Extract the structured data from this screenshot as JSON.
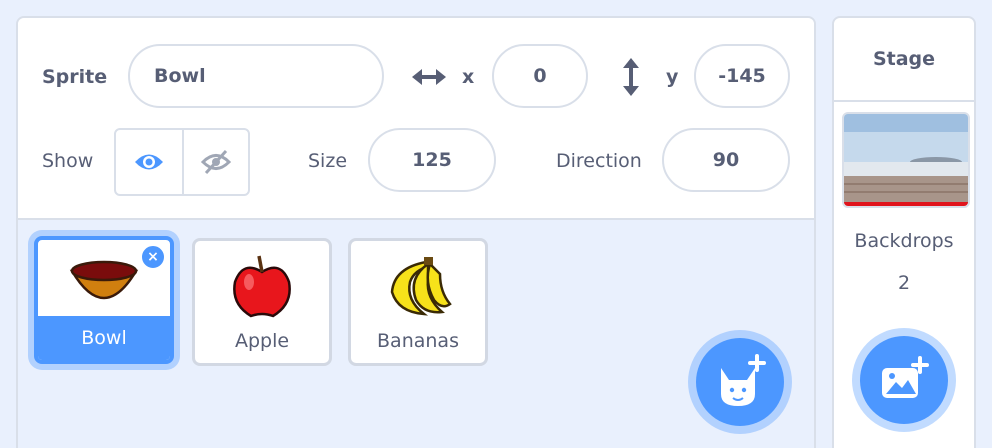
{
  "sprite_info": {
    "sprite_label": "Sprite",
    "sprite_name": "Bowl",
    "x_label": "x",
    "x_value": "0",
    "y_label": "y",
    "y_value": "-145",
    "show_label": "Show",
    "show_visible": true,
    "size_label": "Size",
    "size_value": "125",
    "direction_label": "Direction",
    "direction_value": "90"
  },
  "sprites": [
    {
      "name": "Bowl",
      "selected": true
    },
    {
      "name": "Apple",
      "selected": false
    },
    {
      "name": "Bananas",
      "selected": false
    }
  ],
  "icons": {
    "x_axis": "horizontal-arrows-icon",
    "y_axis": "vertical-arrows-icon",
    "show": "eye-icon",
    "hide": "eye-slash-icon",
    "delete": "close-icon",
    "add_sprite": "cat-plus-icon",
    "add_backdrop": "image-plus-icon"
  },
  "stage": {
    "title": "Stage",
    "backdrops_label": "Backdrops",
    "backdrops_count": "2"
  },
  "colors": {
    "accent": "#4c97ff",
    "text": "#575e75",
    "border": "#d9dfe9",
    "background": "#e9f0fd"
  }
}
